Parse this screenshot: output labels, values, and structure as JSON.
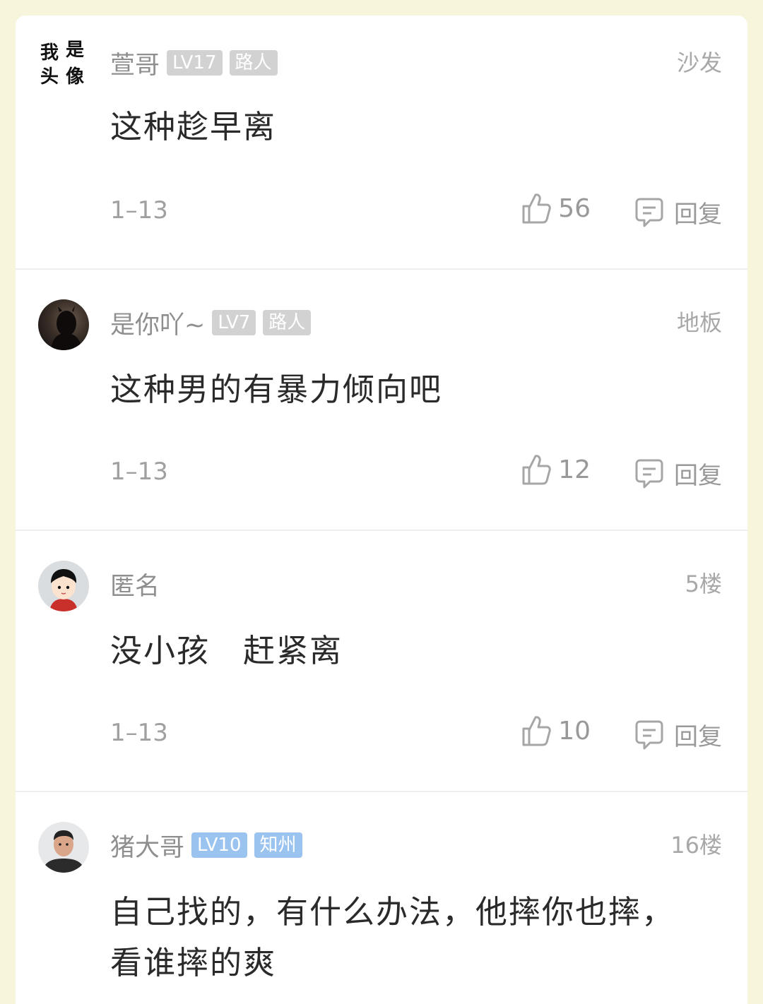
{
  "comments": [
    {
      "username": "萱哥",
      "level": "LV17",
      "tag": "路人",
      "tag_style": "gray",
      "floor": "沙发",
      "content": "这种趁早离",
      "date": "1–13",
      "likes": "56",
      "reply_label": "回复",
      "avatar_text": [
        "我",
        "是",
        "头",
        "像"
      ]
    },
    {
      "username": "是你吖~",
      "level": "LV7",
      "tag": "路人",
      "tag_style": "gray",
      "floor": "地板",
      "content": "这种男的有暴力倾向吧",
      "date": "1–13",
      "likes": "12",
      "reply_label": "回复"
    },
    {
      "username": "匿名",
      "floor": "5楼",
      "content": "没小孩　赶紧离",
      "date": "1–13",
      "likes": "10",
      "reply_label": "回复"
    },
    {
      "username": "猪大哥",
      "level": "LV10",
      "tag": "知州",
      "tag_style": "blue",
      "floor": "16楼",
      "content_line1": "自己找的，有什么办法，他摔你也摔，",
      "content_line2": "看谁摔的爽"
    }
  ],
  "colors": {
    "background": "#f7f5dc",
    "card": "#ffffff",
    "badge_gray": "#d2d2d2",
    "badge_blue": "#9bc3f0"
  }
}
